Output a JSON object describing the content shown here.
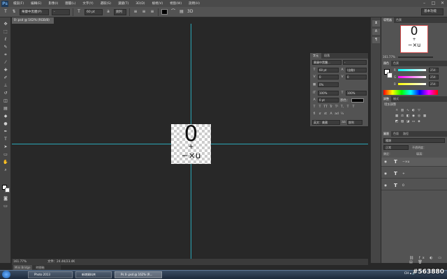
{
  "app": {
    "logo": "Ps"
  },
  "menubar": {
    "items": [
      "檔案(F)",
      "編輯(E)",
      "影像(I)",
      "圖層(L)",
      "文字(Y)",
      "選取(S)",
      "濾鏡(T)",
      "3D(D)",
      "檢視(V)",
      "視窗(W)",
      "說明(H)"
    ]
  },
  "optbar": {
    "font_family": "華康中黑體(P)",
    "font_style": "-",
    "font_size": "60 pt",
    "antialias": "銳利",
    "workspace": "基本功能"
  },
  "document": {
    "tab_title": "0-.psd @ 162% (RGB/8)",
    "glyph_top": "0",
    "glyph_mid": "+",
    "glyph_bottom": "−×u"
  },
  "status": {
    "zoom": "161.77%",
    "file": "文件：24.4K/23.4K"
  },
  "minibridge": {
    "tab1": "Mini Bridge",
    "tab2": "時間軸"
  },
  "character_panel": {
    "tab_character": "字元",
    "tab_paragraph": "段落",
    "font": "華康中黑體...",
    "style": "-",
    "size": "60 pt",
    "leading": "(自動)",
    "kerning": "0",
    "tracking": "0",
    "vscale_pct": "0%",
    "v_scale": "100%",
    "h_scale": "100%",
    "baseline": "0 pt",
    "color_label": "顏色：",
    "language": "英文：美國",
    "aa": "銳利",
    "format_buttons": [
      "T",
      "T",
      "TT",
      "Tr",
      "T¹",
      "T,",
      "T",
      "T"
    ]
  },
  "navigator": {
    "tabs": [
      "導覽器",
      "色票"
    ],
    "thumb_top": "0",
    "thumb_mid": "+",
    "thumb_bottom": "−×u",
    "zoom": "161.77%"
  },
  "color_panel": {
    "tabs": [
      "顏色",
      "色票"
    ],
    "rows": [
      {
        "label": "R",
        "value": "254"
      },
      {
        "label": "G",
        "value": "254"
      },
      {
        "label": "B",
        "value": "254"
      }
    ]
  },
  "adjust_panel": {
    "tabs": [
      "調整",
      "樣式"
    ],
    "title": "增加調整"
  },
  "layers_panel": {
    "tabs": [
      "圖層",
      "色版",
      "路徑"
    ],
    "kind": "種類",
    "blend": "正常",
    "opacity": "不透明度：",
    "lock": "鎖定：",
    "fill": "填滿：",
    "layers": [
      {
        "name": "−×u"
      },
      {
        "name": "+"
      },
      {
        "name": "0"
      }
    ]
  },
  "taskbar": {
    "tasks": [
      "Photo 2013",
      "新增資料夾",
      "Ps 0-.psd @ 162% (R..."
    ],
    "tray": "CH ▴ 🔈"
  },
  "watermark": "#563880"
}
